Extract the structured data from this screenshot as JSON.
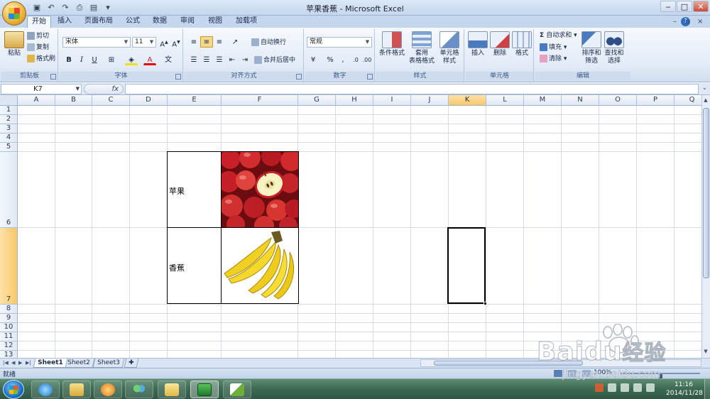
{
  "window": {
    "title": "苹果香蕉 - Microsoft Excel"
  },
  "tabs": [
    "开始",
    "插入",
    "页面布局",
    "公式",
    "数据",
    "审阅",
    "视图",
    "加载项"
  ],
  "ribbon": {
    "clipboard": {
      "label": "剪贴板",
      "paste": "粘贴",
      "cut": "剪切",
      "copy": "复制",
      "format_painter": "格式刷"
    },
    "font": {
      "label": "字体",
      "name": "宋体",
      "size": "11",
      "bold": "B",
      "italic": "I",
      "underline": "U"
    },
    "alignment": {
      "label": "对齐方式",
      "wrap": "自动换行",
      "merge": "合并后居中"
    },
    "number": {
      "label": "数字",
      "format": "常规",
      "percent": "%"
    },
    "styles": {
      "label": "样式",
      "conditional": "条件格式",
      "table_line1": "套用",
      "table_line2": "表格格式",
      "cell_line1": "单元格",
      "cell_line2": "样式"
    },
    "cells": {
      "label": "单元格",
      "insert": "插入",
      "delete": "删除",
      "format": "格式"
    },
    "editing": {
      "label": "编辑",
      "autosum": "自动求和",
      "fill": "填充",
      "clear": "清除",
      "sort_line1": "排序和",
      "sort_line2": "筛选",
      "find_line1": "查找和",
      "find_line2": "选择"
    }
  },
  "formula_bar": {
    "name_box": "K7",
    "fx": "fx",
    "value": ""
  },
  "grid": {
    "columns": [
      "A",
      "B",
      "C",
      "D",
      "E",
      "F",
      "G",
      "H",
      "I",
      "J",
      "K",
      "L",
      "M",
      "N",
      "O",
      "P",
      "Q"
    ],
    "rows": [
      "1",
      "2",
      "3",
      "4",
      "5",
      "6",
      "7",
      "8",
      "9",
      "10",
      "11",
      "12",
      "13"
    ],
    "selected_column": "K",
    "selected_row": "7",
    "cells": {
      "E6": "苹果",
      "E7": "香蕉"
    }
  },
  "sheets": [
    "Sheet1",
    "Sheet2",
    "Sheet3"
  ],
  "active_sheet": "Sheet1",
  "status": {
    "text": "就绪",
    "zoom": "100%",
    "zoom_level": 0.5
  },
  "taskbar": {
    "time": "11:16",
    "date": "2014/11/28"
  },
  "watermark": {
    "brand": "Baidu",
    "brand_cn": "经验",
    "url": "jingyan.baidu.com"
  },
  "icons": {
    "paste": "paste-clipboard-icon",
    "apple": "apple-image",
    "banana": "banana-image"
  }
}
